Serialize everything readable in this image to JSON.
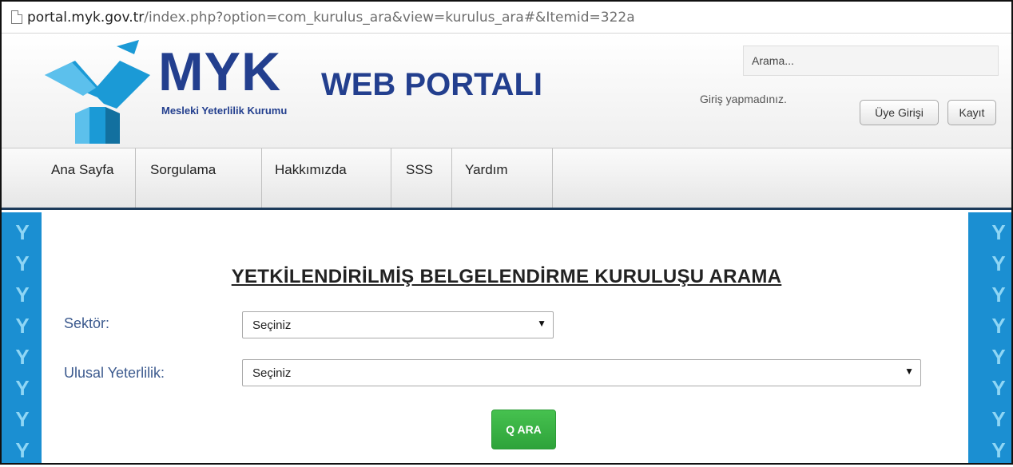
{
  "browser": {
    "url_domain": "portal.myk.gov.tr",
    "url_path": "/index.php?option=com_kurulus_ara&view=kurulus_ara#&Itemid=322a"
  },
  "header": {
    "logo_main": "MYK",
    "logo_sub": "WEB PORTALI",
    "org_name": "Mesleki Yeterlilik Kurumu",
    "search_placeholder": "Arama...",
    "login_status": "Giriş yapmadınız.",
    "login_button": "Üye Girişi",
    "register_button": "Kayıt"
  },
  "nav": {
    "items": [
      "Ana Sayfa",
      "Sorgulama",
      "Hakkımızda",
      "SSS",
      "Yardım"
    ]
  },
  "form": {
    "title": "YETKİLENDİRİLMİŞ BELGELENDİRME KURULUŞU ARAMA",
    "sector_label": "Sektör:",
    "sector_value": "Seçiniz",
    "qualification_label": "Ulusal Yeterlilik:",
    "qualification_value": "Seçiniz",
    "search_button": "Q ARA"
  },
  "colors": {
    "brand_blue": "#233f8e",
    "logo_cyan": "#1b9ad6",
    "button_green": "#3cb447"
  }
}
